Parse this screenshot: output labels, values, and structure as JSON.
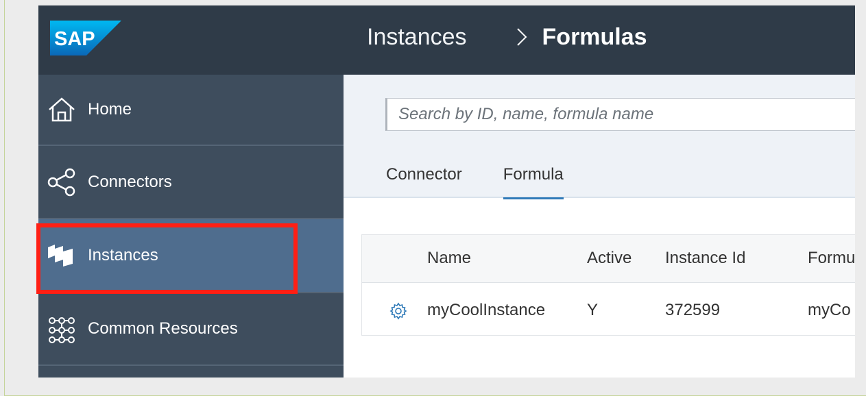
{
  "header": {
    "logo_text": "SAP",
    "breadcrumb_parent": "Instances",
    "breadcrumb_current": "Formulas"
  },
  "sidebar": {
    "items": [
      {
        "label": "Home",
        "icon": "home-icon"
      },
      {
        "label": "Connectors",
        "icon": "share-icon"
      },
      {
        "label": "Instances",
        "icon": "instances-icon",
        "active": true
      },
      {
        "label": "Common Resources",
        "icon": "resources-icon"
      }
    ]
  },
  "search": {
    "placeholder": "Search by ID, name, formula name",
    "value": ""
  },
  "tabs": [
    {
      "label": "Connector",
      "active": false
    },
    {
      "label": "Formula",
      "active": true
    }
  ],
  "table": {
    "columns": [
      "Name",
      "Active",
      "Instance Id",
      "Formu"
    ],
    "rows": [
      {
        "name": "myCoolInstance",
        "active": "Y",
        "instance_id": "372599",
        "formula": "myCo"
      }
    ]
  },
  "colors": {
    "header_bg": "#2f3b48",
    "sidebar_bg": "#3e4d5d",
    "active_item_bg": "#4f6d8e",
    "highlight": "#ff1f14",
    "accent": "#2f7ab8"
  }
}
